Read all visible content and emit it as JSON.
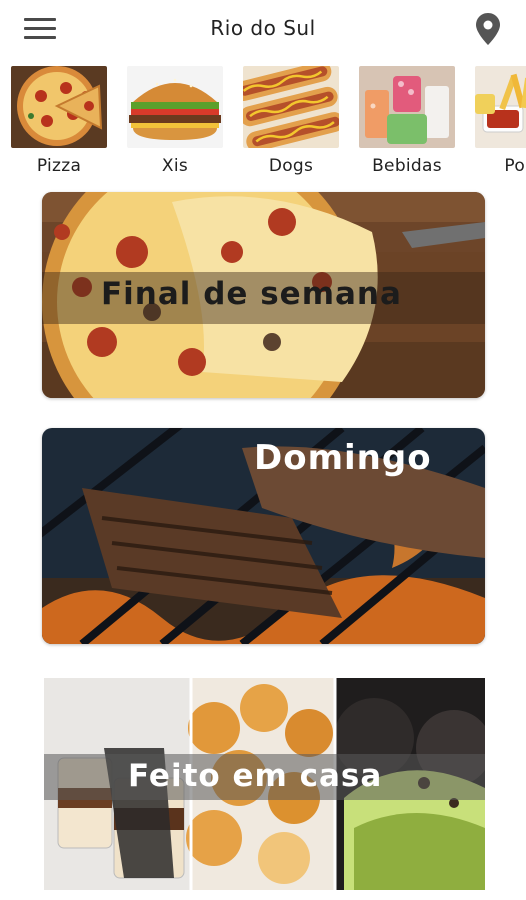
{
  "app": {
    "title": "Rio do Sul"
  },
  "categories": [
    {
      "label": "Pizza"
    },
    {
      "label": "Xis"
    },
    {
      "label": "Dogs"
    },
    {
      "label": "Bebidas"
    },
    {
      "label": "Porç"
    }
  ],
  "banners": [
    {
      "title": "Final de semana"
    },
    {
      "title": "Domingo"
    },
    {
      "title": "Feito em casa"
    }
  ],
  "icons": {
    "menu": "hamburger-menu-icon",
    "location": "map-pin-icon"
  },
  "colors": {
    "icon_gray": "#4a4a4a",
    "text_dark": "#222222"
  }
}
